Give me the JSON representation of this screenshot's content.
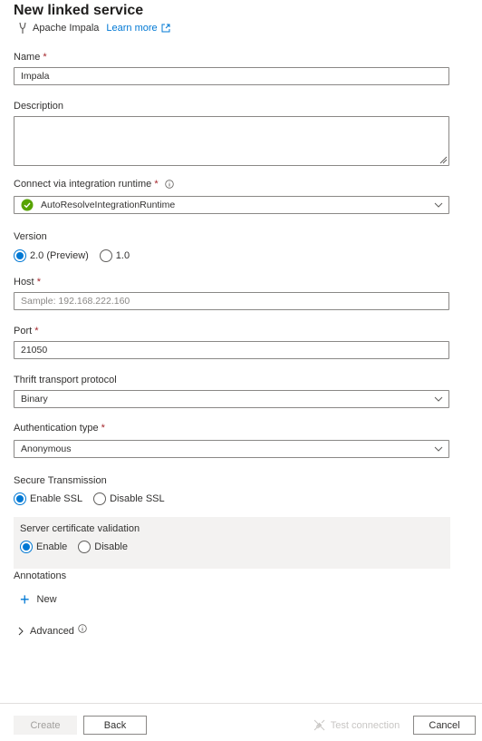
{
  "header": {
    "title": "New linked service",
    "connector": "Apache Impala",
    "learn_more": "Learn more"
  },
  "form": {
    "name_label": "Name",
    "name_value": "Impala",
    "description_label": "Description",
    "description_value": "",
    "runtime_label": "Connect via integration runtime",
    "runtime_value": "AutoResolveIntegrationRuntime",
    "version_label": "Version",
    "version_options": [
      "2.0 (Preview)",
      "1.0"
    ],
    "version_selected": "2.0 (Preview)",
    "host_label": "Host",
    "host_placeholder": "Sample: 192.168.222.160",
    "port_label": "Port",
    "port_value": "21050",
    "thrift_label": "Thrift transport protocol",
    "thrift_value": "Binary",
    "auth_label": "Authentication type",
    "auth_value": "Anonymous",
    "secure_label": "Secure Transmission",
    "secure_options": [
      "Enable SSL",
      "Disable SSL"
    ],
    "secure_selected": "Enable SSL",
    "cert_label": "Server certificate validation",
    "cert_options": [
      "Enable",
      "Disable"
    ],
    "cert_selected": "Enable",
    "annotations_label": "Annotations",
    "new_label": "New",
    "advanced_label": "Advanced"
  },
  "footer": {
    "create": "Create",
    "back": "Back",
    "test_connection": "Test connection",
    "cancel": "Cancel"
  },
  "colors": {
    "accent": "#0078d4",
    "required": "#a4262c",
    "success": "#57a300"
  }
}
